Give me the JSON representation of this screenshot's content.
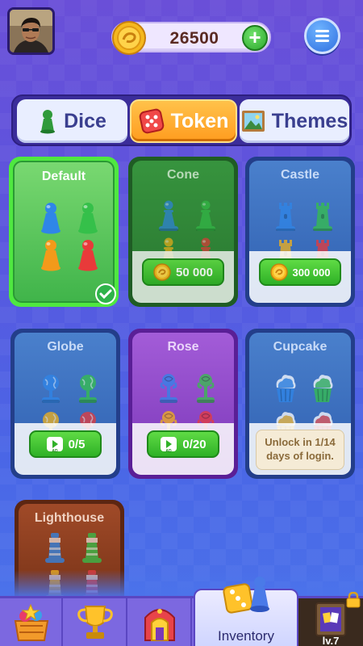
{
  "header": {
    "coins": "26500",
    "plus_icon": "plus-icon",
    "menu_icon": "hamburger-menu-icon"
  },
  "tabs": [
    {
      "label": "Dice",
      "icon": "pawn-icon",
      "active": false
    },
    {
      "label": "Token",
      "icon": "dice-icon",
      "active": true
    },
    {
      "label": "Themes",
      "icon": "picture-icon",
      "active": false
    }
  ],
  "tokens": [
    {
      "name": "Default",
      "status": "selected",
      "colors": {
        "bg": "#3fc24a",
        "frame": "#3fe03a"
      }
    },
    {
      "name": "Cone",
      "price": "50 000",
      "colors": {
        "bg": "#2c8a34",
        "frame": "#1f5c24"
      }
    },
    {
      "name": "Castle",
      "price": "300 000",
      "colors": {
        "bg": "#3a6fc0",
        "frame": "#233e8a"
      }
    },
    {
      "name": "Globe",
      "progress": "0/5",
      "colors": {
        "bg": "#3a6fc0",
        "frame": "#233e8a"
      }
    },
    {
      "name": "Rose",
      "progress": "0/20",
      "colors": {
        "bg": "#8a3fc6",
        "frame": "#5a1f96"
      }
    },
    {
      "name": "Cupcake",
      "unlock_text": "Unlock in 1/14 days of login.",
      "colors": {
        "bg": "#3a6fc0",
        "frame": "#233e8a"
      }
    },
    {
      "name": "Lighthouse",
      "colors": {
        "bg": "#8a3a1f",
        "frame": "#5c2612"
      }
    }
  ],
  "bottom_nav": {
    "items": [
      {
        "name": "shop",
        "icon": "gift-basket-icon"
      },
      {
        "name": "rankings",
        "icon": "trophy-icon"
      },
      {
        "name": "home",
        "icon": "castle-icon"
      },
      {
        "name": "inventory",
        "icon": "dice-pawn-icon",
        "label": "Inventory",
        "active": true
      },
      {
        "name": "cards",
        "icon": "card-book-icon",
        "level": "lv.7",
        "locked": true
      }
    ]
  }
}
